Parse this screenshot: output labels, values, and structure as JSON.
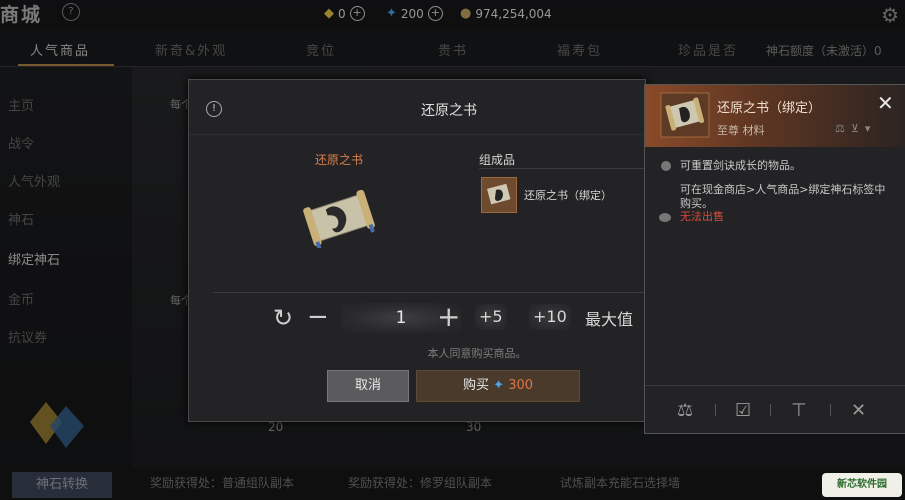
{
  "shop": {
    "title": "商城",
    "help_icon": "?",
    "currencies": [
      {
        "icon": "gold-diamond-icon",
        "value": "0"
      },
      {
        "icon": "blue-crystal-icon",
        "value": "200"
      },
      {
        "icon": "silver-coin-icon",
        "value": "974,254,004"
      }
    ],
    "tabs": [
      "人气商品",
      "新奇&外观",
      "竞位",
      "贵书",
      "福寿包",
      "珍品是否"
    ],
    "stone_status": "神石额度（未激活）0",
    "sidebar": [
      "主页",
      "战令",
      "人气外观",
      "神石",
      "绑定神石",
      "金币",
      "抗议券"
    ],
    "section_labels": [
      "每个",
      "每个"
    ],
    "bottom_button": "神石转换",
    "bottom_items": [
      "奖励获得处：普通组队副本",
      "奖励获得处：修罗组队副本",
      "试炼副本充能石选择墙"
    ],
    "bg_numbers": [
      "20",
      "30"
    ]
  },
  "modal": {
    "title": "还原之书",
    "item_label": "还原之书",
    "component_header": "组成品",
    "component_name": "还原之书（绑定）",
    "quantity": "1",
    "step_small": "+5",
    "step_large": "+10",
    "max_label": "最大值",
    "agree_text": "本人同意购买商品。",
    "cancel_label": "取消",
    "buy_label": "购买",
    "price": "300"
  },
  "detail": {
    "name": "还原之书（绑定）",
    "grade": "至尊 材料",
    "desc1": "可重置剑诀成长的物品。",
    "desc2": "可在现金商店>人气商品>绑定神石标签中购买。",
    "not_sellable": "无法出售"
  },
  "watermark": "新芯软件园"
}
